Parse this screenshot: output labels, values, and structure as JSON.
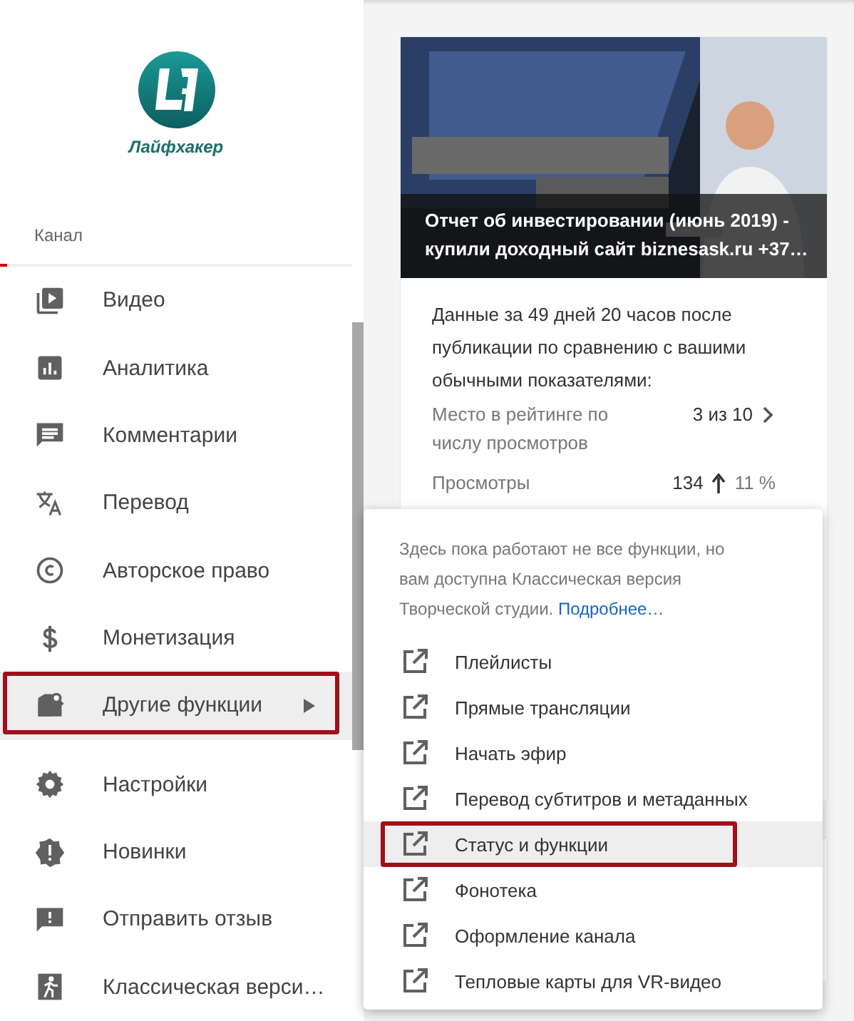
{
  "sidebar": {
    "logo": {
      "caption": "Лайфхакер"
    },
    "section": {
      "label": "Канал",
      "selected": true
    },
    "items": [
      {
        "label": "Видео",
        "selected": false,
        "annotated": false,
        "submenu": false
      },
      {
        "label": "Аналитика",
        "selected": false,
        "annotated": false,
        "submenu": false
      },
      {
        "label": "Комментарии",
        "selected": false,
        "annotated": false,
        "submenu": false
      },
      {
        "label": "Перевод",
        "selected": false,
        "annotated": false,
        "submenu": false
      },
      {
        "label": "Авторское право",
        "selected": false,
        "annotated": false,
        "submenu": false
      },
      {
        "label": "Монетизация",
        "selected": false,
        "annotated": false,
        "submenu": false
      },
      {
        "label": "Другие функции",
        "selected": true,
        "annotated": true,
        "submenu": true
      },
      {
        "label": "Настройки",
        "selected": false,
        "annotated": false,
        "submenu": false
      },
      {
        "label": "Новинки",
        "selected": false,
        "annotated": false,
        "submenu": false
      },
      {
        "label": "Отправить отзыв",
        "selected": false,
        "annotated": false,
        "submenu": false
      },
      {
        "label": "Классическая верси…",
        "selected": false,
        "annotated": false,
        "submenu": false
      }
    ]
  },
  "video_card": {
    "title": "Отчет об инвестировании (июнь 2019) - купили доходный сайт biznesask.ru +37…",
    "summary": "Данные за 49 дней 20 часов после публикации по сравнению с вашими обычными показателями:",
    "stats": [
      {
        "kind": "rank",
        "label": "Место в рейтинге по числу просмотров",
        "value": "3 из 10"
      },
      {
        "kind": "views",
        "label": "Просмотры",
        "value": "134",
        "change": "11 %"
      }
    ]
  },
  "popup_menu": {
    "notice": "Здесь пока работают не все функции, но вам доступна Классическая версия Творческой студии.",
    "link": "Подробнее…",
    "items": [
      {
        "label": "Плейлисты",
        "selected": false,
        "annotated": false
      },
      {
        "label": "Прямые трансляции",
        "selected": false,
        "annotated": false
      },
      {
        "label": "Начать эфир",
        "selected": false,
        "annotated": false
      },
      {
        "label": "Перевод субтитров и метаданных",
        "selected": false,
        "annotated": false
      },
      {
        "label": "Статус и функции",
        "selected": true,
        "annotated": true
      },
      {
        "label": "Фонотека",
        "selected": false,
        "annotated": false
      },
      {
        "label": "Оформление канала",
        "selected": false,
        "annotated": false
      },
      {
        "label": "Тепловые карты для VR-видео",
        "selected": false,
        "annotated": false
      }
    ]
  }
}
